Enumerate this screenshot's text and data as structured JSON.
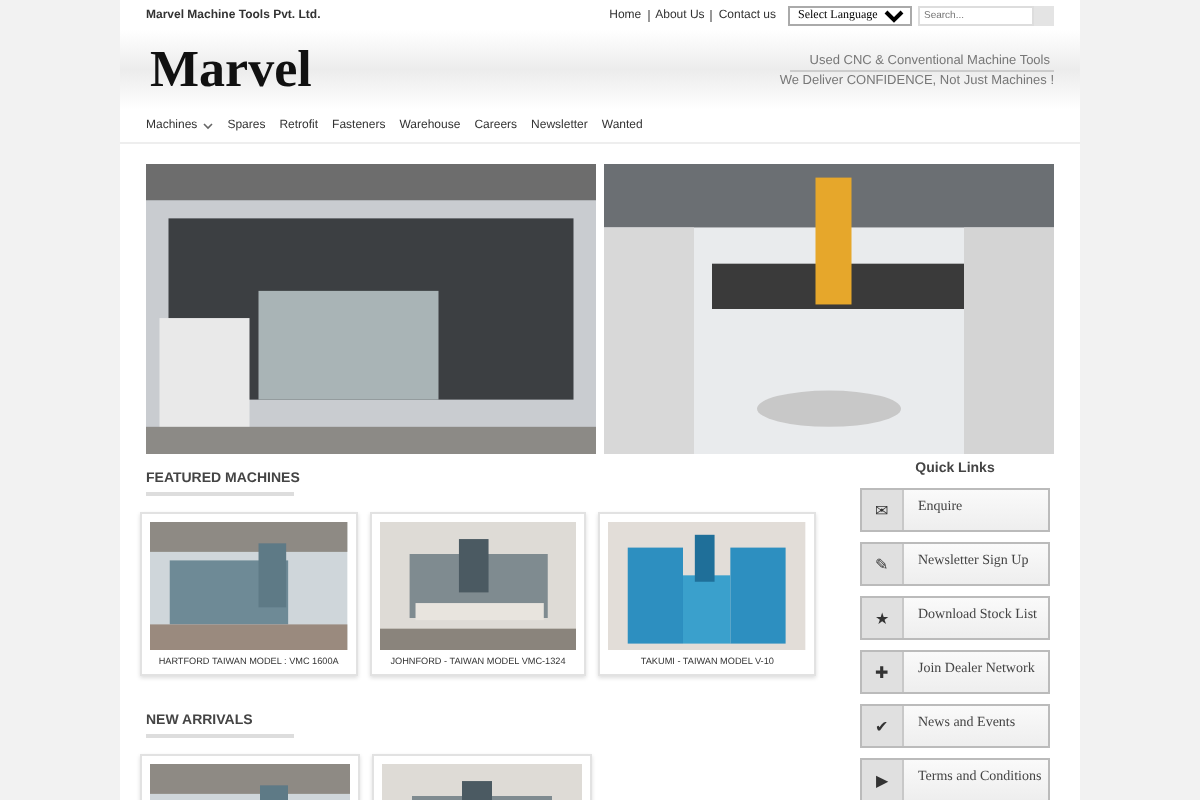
{
  "top_bar": {
    "company": "Marvel Machine Tools Pvt. Ltd.",
    "links": [
      "Home",
      "About Us",
      "Contact us"
    ],
    "language": "Select Language",
    "search": {
      "placeholder": "Search..."
    }
  },
  "header": {
    "logo": "Marvel",
    "tagline": [
      "Used CNC & Conventional Machine Tools",
      "We Deliver CONFIDENCE, Not Just Machines !"
    ]
  },
  "nav": [
    {
      "label": "Machines",
      "dropdown": true
    },
    {
      "label": "Spares",
      "dropdown": false
    },
    {
      "label": "Retrofit",
      "dropdown": false
    },
    {
      "label": "Fasteners",
      "dropdown": false
    },
    {
      "label": "Warehouse",
      "dropdown": false
    },
    {
      "label": "Careers",
      "dropdown": false
    },
    {
      "label": "Newsletter",
      "dropdown": false
    },
    {
      "label": "Wanted",
      "dropdown": false
    }
  ],
  "banner": [
    {
      "kind": "photo"
    },
    {
      "kind": "photo"
    }
  ],
  "sections": [
    {
      "title": "FEATURED MACHINES",
      "cards": [
        {
          "kind": "captioned",
          "caption": "HARTFORD TAIWAN MODEL : VMC 1600A"
        },
        {
          "kind": "captioned",
          "caption": "JOHNFORD - TAIWAN MODEL VMC-1324"
        },
        {
          "kind": "captioned",
          "caption": "TAKUMI - TAIWAN MODEL V-10"
        }
      ]
    },
    {
      "title": "NEW ARRIVALS",
      "cards": [
        {
          "kind": "photo"
        },
        {
          "kind": "photo"
        }
      ]
    }
  ],
  "quick_links": {
    "title": "Quick Links",
    "items": [
      {
        "icon": "✉",
        "label": "Enquire"
      },
      {
        "icon": "✎",
        "label": "Newsletter Sign Up"
      },
      {
        "icon": "★",
        "label": "Download Stock List"
      },
      {
        "icon": "✚",
        "label": "Join Dealer Network"
      },
      {
        "icon": "✔",
        "label": "News and Events"
      },
      {
        "icon": "▶",
        "label": "Terms and Conditions"
      }
    ]
  }
}
